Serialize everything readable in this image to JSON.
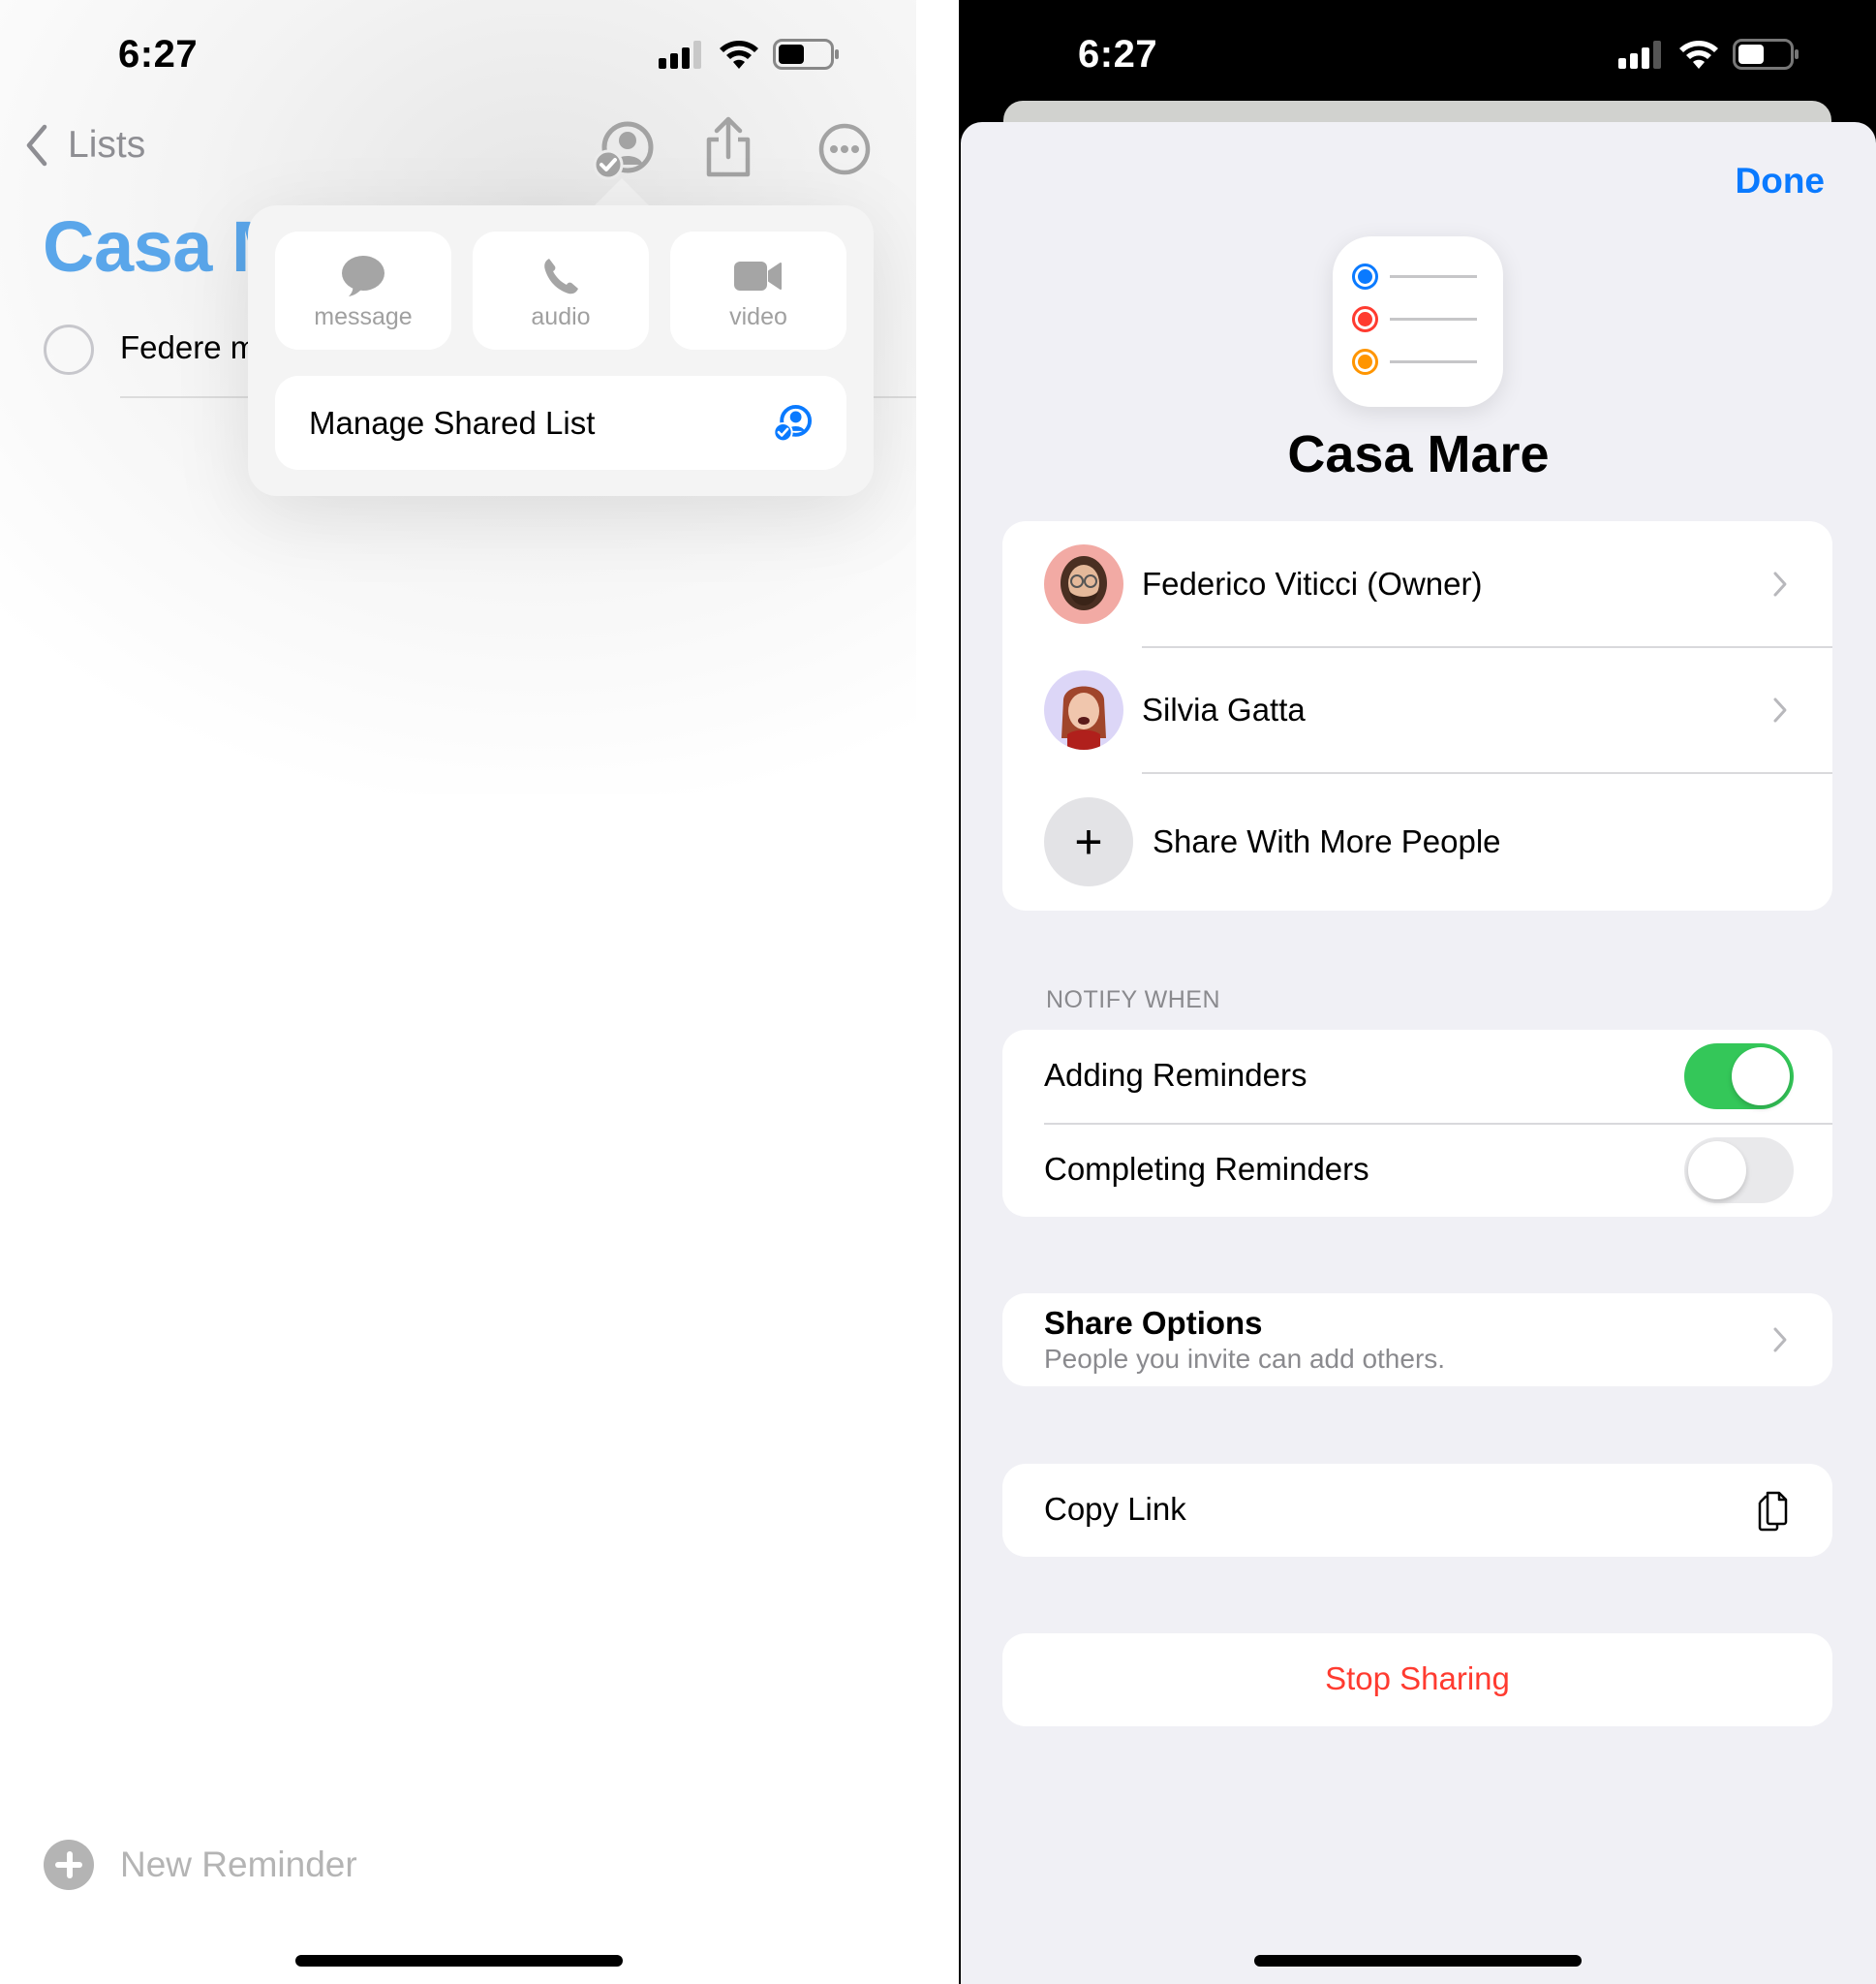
{
  "left_screen": {
    "status_bar": {
      "time": "6:27"
    },
    "nav": {
      "back_label": "Lists"
    },
    "list_title": "Casa M",
    "reminders": [
      {
        "title": "Federe m",
        "completed": false
      }
    ],
    "popover": {
      "actions": [
        {
          "label": "message",
          "icon": "message-bubble-icon"
        },
        {
          "label": "audio",
          "icon": "phone-icon"
        },
        {
          "label": "video",
          "icon": "video-camera-icon"
        }
      ],
      "manage_label": "Manage Shared List"
    },
    "new_reminder_label": "New Reminder"
  },
  "right_screen": {
    "status_bar": {
      "time": "6:27"
    },
    "done_label": "Done",
    "list_name": "Casa Mare",
    "list_icon_colors": [
      "#0a7aff",
      "#ff3b30",
      "#ff9500"
    ],
    "members": [
      {
        "name": "Federico Viticci (Owner)",
        "avatar_bg": "#f2aaa4"
      },
      {
        "name": "Silvia Gatta",
        "avatar_bg": "#dcd6f7"
      }
    ],
    "share_more_label": "Share With More People",
    "notify_header": "NOTIFY WHEN",
    "notify_options": [
      {
        "label": "Adding Reminders",
        "enabled": true
      },
      {
        "label": "Completing Reminders",
        "enabled": false
      }
    ],
    "share_options": {
      "title": "Share Options",
      "subtitle": "People you invite can add others."
    },
    "copy_link_label": "Copy Link",
    "stop_sharing_label": "Stop Sharing"
  },
  "colors": {
    "accent": "#0a7aff",
    "toggle_on": "#34c759",
    "destructive": "#ff3b30",
    "title_blue": "#5aa6ea"
  }
}
